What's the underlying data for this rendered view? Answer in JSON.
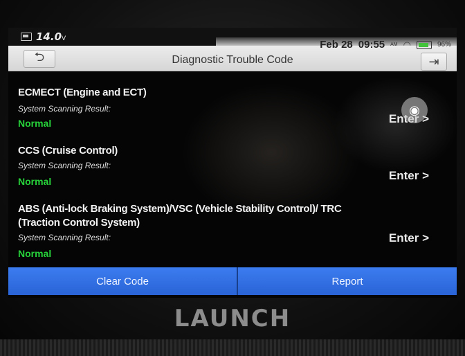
{
  "status_bar": {
    "voltage": "14.0",
    "voltage_unit": "V",
    "date": "Feb 28",
    "time": "09:55",
    "ampm": "AM",
    "battery": "96%"
  },
  "header": {
    "title": "Diagnostic Trouble Code"
  },
  "systems": [
    {
      "name": "ECMECT (Engine and ECT)",
      "sub_label": "System Scanning Result:",
      "status": "Normal",
      "action": "Enter >"
    },
    {
      "name": "CCS (Cruise Control)",
      "sub_label": "System Scanning Result:",
      "status": "Normal",
      "action": "Enter >"
    },
    {
      "name": "ABS (Anti-lock Braking System)/VSC (Vehicle Stability Control)/ TRC (Traction Control System)",
      "sub_label": "System Scanning Result:",
      "status": "Normal",
      "action": "Enter >"
    }
  ],
  "footer": {
    "clear_label": "Clear Code",
    "report_label": "Report"
  },
  "brand": "LAUNCH",
  "colors": {
    "accent_blue": "#3b7cf0",
    "status_green": "#27d33a"
  },
  "icons": [
    "back-arrow-icon",
    "exit-icon",
    "camera-icon",
    "wifi-icon",
    "battery-icon"
  ]
}
